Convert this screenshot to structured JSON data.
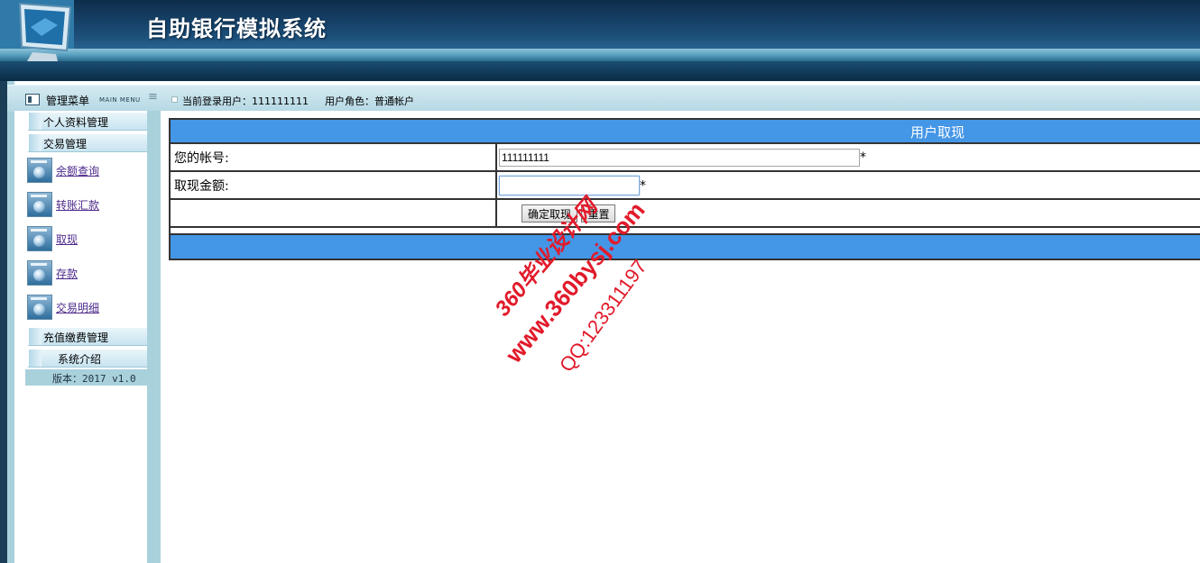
{
  "header": {
    "title": "自助银行模拟系统"
  },
  "menu": {
    "title": "管理菜单",
    "sub": "MAIN MENU"
  },
  "userbar": {
    "login_label": "当前登录用户：",
    "login_user": "111111111",
    "role_label": "用户角色：",
    "role": "普通帐户"
  },
  "sidebar": {
    "sections": {
      "profile": "个人资料管理",
      "trade": "交易管理",
      "recharge": "充值缴费管理",
      "about": "系统介绍"
    },
    "items": [
      "余额查询",
      "转账汇款",
      "取现",
      "存款",
      "交易明细"
    ],
    "version": "版本：2017 v1.0"
  },
  "form": {
    "title": "用户取现",
    "account_label": "您的帐号:",
    "account_value": "111111111",
    "amount_label": "取现金额:",
    "amount_value": "",
    "required_mark": "*",
    "submit_label": "确定取现",
    "reset_label": "重置"
  },
  "watermark": {
    "line1": "360毕业设计网",
    "line2": "www.360bysj.com",
    "line3": "QQ:123311197"
  },
  "colors": {
    "accent": "#4496e6",
    "header": "#1c4f7a",
    "frame": "#a9d1dc"
  }
}
